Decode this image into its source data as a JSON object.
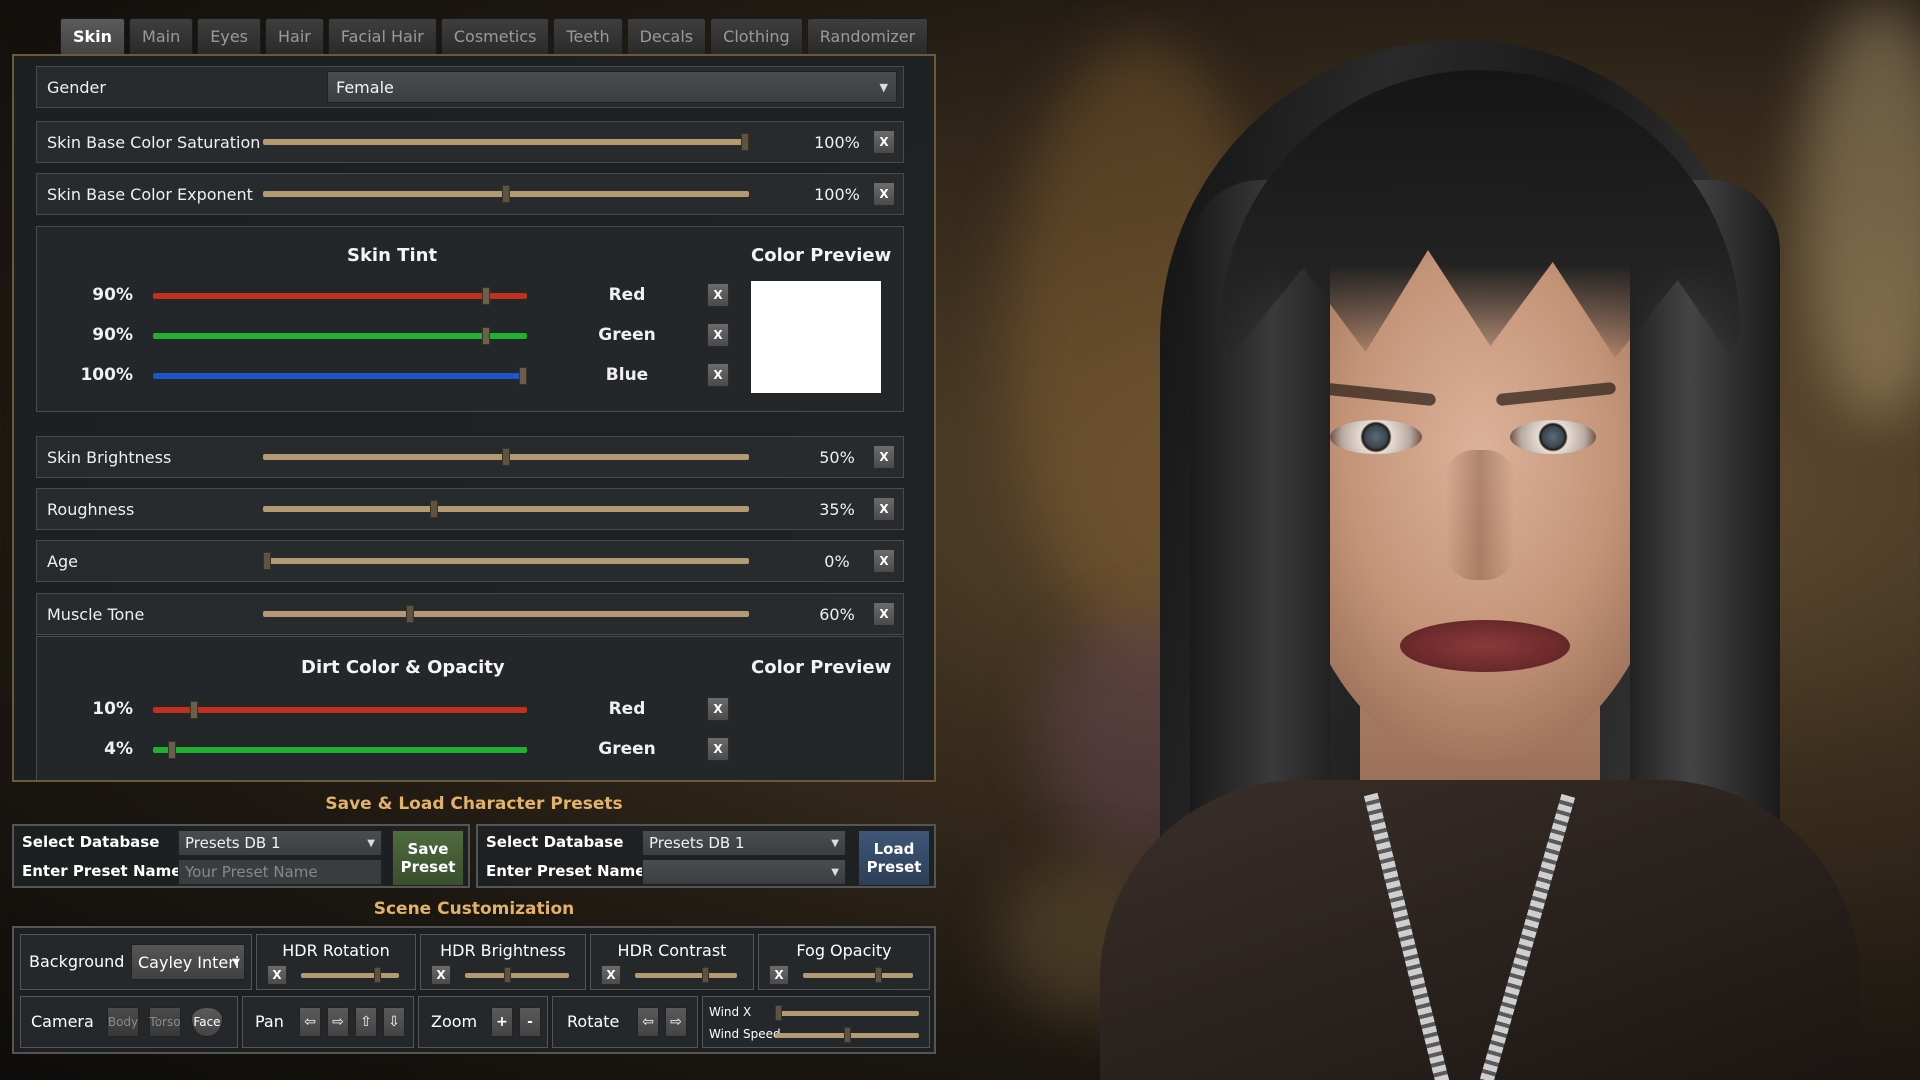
{
  "tabs": [
    {
      "label": "Skin",
      "active": true
    },
    {
      "label": "Main"
    },
    {
      "label": "Eyes"
    },
    {
      "label": "Hair"
    },
    {
      "label": "Facial Hair"
    },
    {
      "label": "Cosmetics"
    },
    {
      "label": "Teeth"
    },
    {
      "label": "Decals"
    },
    {
      "label": "Clothing"
    },
    {
      "label": "Randomizer"
    }
  ],
  "gender": {
    "label": "Gender",
    "value": "Female"
  },
  "sliders": [
    {
      "label": "Skin Base Color Saturation",
      "value": "100%",
      "fraction": 1.0
    },
    {
      "label": "Skin Base Color Exponent",
      "value": "100%",
      "fraction": 0.5
    },
    {
      "label": "Skin Brightness",
      "value": "50%",
      "fraction": 0.5
    },
    {
      "label": "Roughness",
      "value": "35%",
      "fraction": 0.35
    },
    {
      "label": "Age",
      "value": "0%",
      "fraction": 0.0
    },
    {
      "label": "Muscle Tone",
      "value": "60%",
      "fraction": 0.3
    }
  ],
  "reset_label": "X",
  "skin_tint": {
    "title": "Skin Tint",
    "preview_title": "Color Preview",
    "preview_color": "#ffffff",
    "channels": [
      {
        "pct": "90%",
        "name": "Red",
        "fraction": 0.9,
        "color": "#c0301e"
      },
      {
        "pct": "90%",
        "name": "Green",
        "fraction": 0.9,
        "color": "#22b033"
      },
      {
        "pct": "100%",
        "name": "Blue",
        "fraction": 1.0,
        "color": "#1f55c8"
      }
    ]
  },
  "dirt": {
    "title": "Dirt Color & Opacity",
    "preview_title": "Color Preview",
    "channels": [
      {
        "pct": "10%",
        "name": "Red",
        "fraction": 0.1,
        "color": "#c0301e"
      },
      {
        "pct": "4%",
        "name": "Green",
        "fraction": 0.04,
        "color": "#22b033"
      }
    ]
  },
  "presets": {
    "title": "Save & Load Character Presets",
    "save": {
      "select_label": "Select Database",
      "select_value": "Presets DB 1",
      "name_label": "Enter Preset Name",
      "name_placeholder": "Your Preset Name",
      "button_line1": "Save",
      "button_line2": "Preset"
    },
    "load": {
      "select_label": "Select Database",
      "select_value": "Presets DB 1",
      "name_label": "Enter Preset Name",
      "name_value": "",
      "button_line1": "Load",
      "button_line2": "Preset"
    }
  },
  "scene": {
    "title": "Scene Customization",
    "background_label": "Background",
    "background_value": "Cayley Interi",
    "hdr_rotation": {
      "label": "HDR Rotation",
      "fraction": 0.8
    },
    "hdr_brightness": {
      "label": "HDR Brightness",
      "fraction": 0.4
    },
    "hdr_contrast": {
      "label": "HDR Contrast",
      "fraction": 0.7
    },
    "fog_opacity": {
      "label": "Fog Opacity",
      "fraction": 0.7
    },
    "camera_label": "Camera",
    "camera_buttons": [
      "Body",
      "Torso",
      "Face"
    ],
    "pan_label": "Pan",
    "pan_icons": [
      "⇦",
      "⇨",
      "⇧",
      "⇩"
    ],
    "zoom_label": "Zoom",
    "zoom_icons": [
      "+",
      "-"
    ],
    "rotate_label": "Rotate",
    "rotate_icons": [
      "⇦",
      "⇨"
    ],
    "wind_x": {
      "label": "Wind X",
      "fraction": 0.0
    },
    "wind_speed": {
      "label": "Wind Speed",
      "fraction": 0.5
    }
  }
}
